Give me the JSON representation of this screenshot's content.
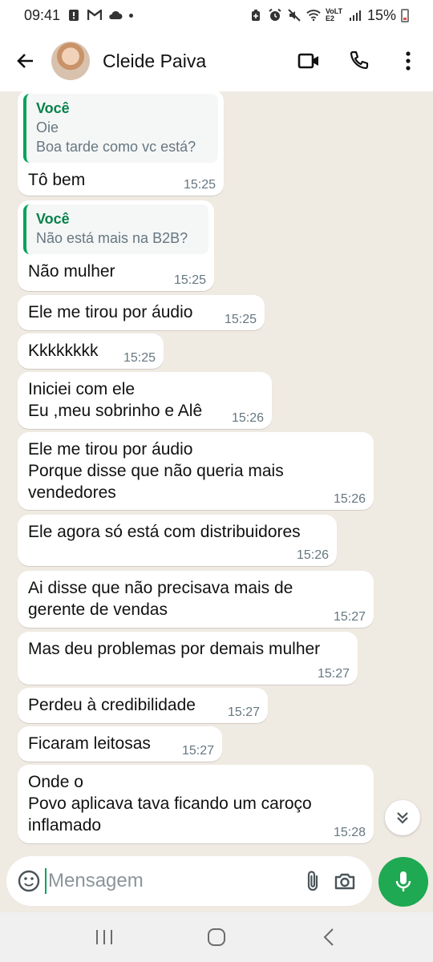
{
  "status_bar": {
    "time": "09:41",
    "battery": "15%",
    "network": "VoLTE2"
  },
  "header": {
    "contact_name": "Cleide Paiva"
  },
  "messages": [
    {
      "quote_author": "Você",
      "quote_text": "Oie\nBoa tarde como vc está?",
      "text": "Tô bem",
      "time": "15:25"
    },
    {
      "quote_author": "Você",
      "quote_text": "Não está mais na B2B?",
      "text": "Não mulher",
      "time": "15:25"
    },
    {
      "text": "Ele me tirou por áudio",
      "time": "15:25"
    },
    {
      "text": "Kkkkkkkk",
      "time": "15:25"
    },
    {
      "text": "Iniciei com ele\nEu ,meu sobrinho e Alê",
      "time": "15:26"
    },
    {
      "text": "Ele me tirou por áudio\nPorque disse que não queria mais\nvendedores",
      "time": "15:26"
    },
    {
      "text": "Ele agora só está com distribuidores",
      "time": "15:26"
    },
    {
      "text": "Ai disse que não precisava mais de\ngerente de vendas",
      "time": "15:27"
    },
    {
      "text": "Mas deu problemas por demais mulher",
      "time": "15:27"
    },
    {
      "text": "Perdeu à credibilidade",
      "time": "15:27"
    },
    {
      "text": "Ficaram leitosas",
      "time": "15:27"
    },
    {
      "text": "Onde o\nPovo aplicava tava ficando um caroço\ninflamado",
      "time": "15:28"
    }
  ],
  "input": {
    "placeholder": "Mensagem",
    "value": ""
  },
  "colors": {
    "accent": "#1ea952",
    "quote_bar": "#06a35a",
    "chat_background": "#efeae2"
  },
  "icons": {
    "back": "arrow-left-icon",
    "video": "video-camera-icon",
    "call": "phone-icon",
    "menu": "more-vertical-icon",
    "emoji": "sticker-icon",
    "attach": "paperclip-icon",
    "camera": "camera-icon",
    "mic": "microphone-icon",
    "scroll": "double-chevron-down-icon"
  }
}
